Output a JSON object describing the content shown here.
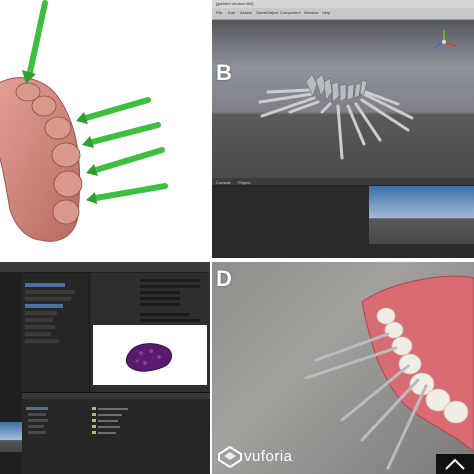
{
  "panels": {
    "a": {
      "letter": ""
    },
    "b": {
      "letter": "B",
      "title_bar": "[garbled window title]",
      "menu": [
        "File",
        "Edit",
        "Assets",
        "GameObject",
        "Component",
        "Window",
        "Help"
      ],
      "bottom_tabs": [
        "Console",
        "Project"
      ]
    },
    "c": {
      "letter": ""
    },
    "d": {
      "letter": "D",
      "brand": "vuforia"
    }
  },
  "colors": {
    "gums": "#d96b73",
    "arrow": "#3fbf3f",
    "tooth_model": "#c98b7d",
    "mesh_purple": "#5a1a6e",
    "unity_dark": "#2c2c2c"
  },
  "icons": [
    "vuforia-logo-icon",
    "unity-axis-gizmo-icon",
    "expand-icon"
  ]
}
